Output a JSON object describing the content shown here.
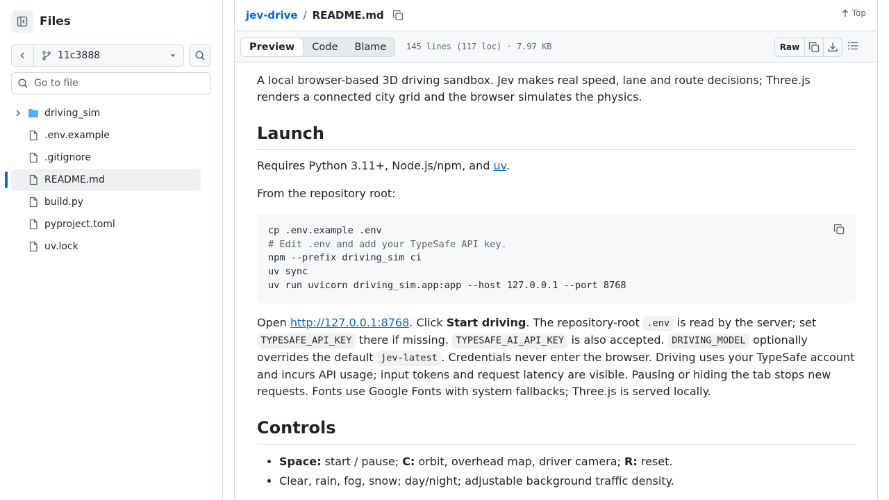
{
  "sidebar": {
    "title": "Files",
    "branch": "11c3888",
    "goto_placeholder": "Go to file",
    "items": [
      {
        "name": "driving_sim",
        "type": "folder"
      },
      {
        "name": ".env.example",
        "type": "file"
      },
      {
        "name": ".gitignore",
        "type": "file"
      },
      {
        "name": "README.md",
        "type": "file",
        "active": true
      },
      {
        "name": "build.py",
        "type": "file"
      },
      {
        "name": "pyproject.toml",
        "type": "file"
      },
      {
        "name": "uv.lock",
        "type": "file"
      }
    ]
  },
  "header": {
    "repo": "jev-drive",
    "separator": "/",
    "file": "README.md",
    "top_label": "Top"
  },
  "toolbar": {
    "tabs": [
      "Preview",
      "Code",
      "Blame"
    ],
    "meta": "145 lines (117 loc) · 7.97 KB",
    "raw_label": "Raw"
  },
  "readme": {
    "intro": "A local browser-based 3D driving sandbox. Jev makes real speed, lane and route decisions; Three.js renders a connected city grid and the browser simulates the physics.",
    "launch_heading": "Launch",
    "requires_before": "Requires Python 3.11+, Node.js/npm, and ",
    "requires_link": "uv",
    "requires_after": ".",
    "from_root": "From the repository root:",
    "code_lines": [
      "cp .env.example .env",
      "# Edit .env and add your TypeSafe API key.",
      "npm --prefix driving_sim ci",
      "uv sync",
      "uv run uvicorn driving_sim.app:app --host 127.0.0.1 --port 8768"
    ],
    "open": {
      "t1": "Open ",
      "link": "http://127.0.0.1:8768",
      "t2": ". Click ",
      "bold1": "Start driving",
      "t3": ". The repository-root ",
      "code1": ".env",
      "t4": " is read by the server; set ",
      "code2": "TYPESAFE_API_KEY",
      "t5": " there if missing. ",
      "code3": "TYPESAFE_AI_API_KEY",
      "t6": " is also accepted. ",
      "code4": "DRIVING_MODEL",
      "t7": " optionally overrides the default ",
      "code5": "jev-latest",
      "t8": ". Credentials never enter the browser. Driving uses your TypeSafe account and incurs API usage; input tokens and request latency are visible. Pausing or hiding the tab stops new requests. Fonts use Google Fonts with system fallbacks; Three.js is served locally."
    },
    "controls_heading": "Controls",
    "controls": {
      "b1": "Space:",
      "t1": " start / pause; ",
      "b2": "C:",
      "t2": " orbit, overhead map, driver camera; ",
      "b3": "R:",
      "t3": " reset.",
      "item2": "Clear, rain, fog, snow; day/night; adjustable background traffic density."
    }
  }
}
